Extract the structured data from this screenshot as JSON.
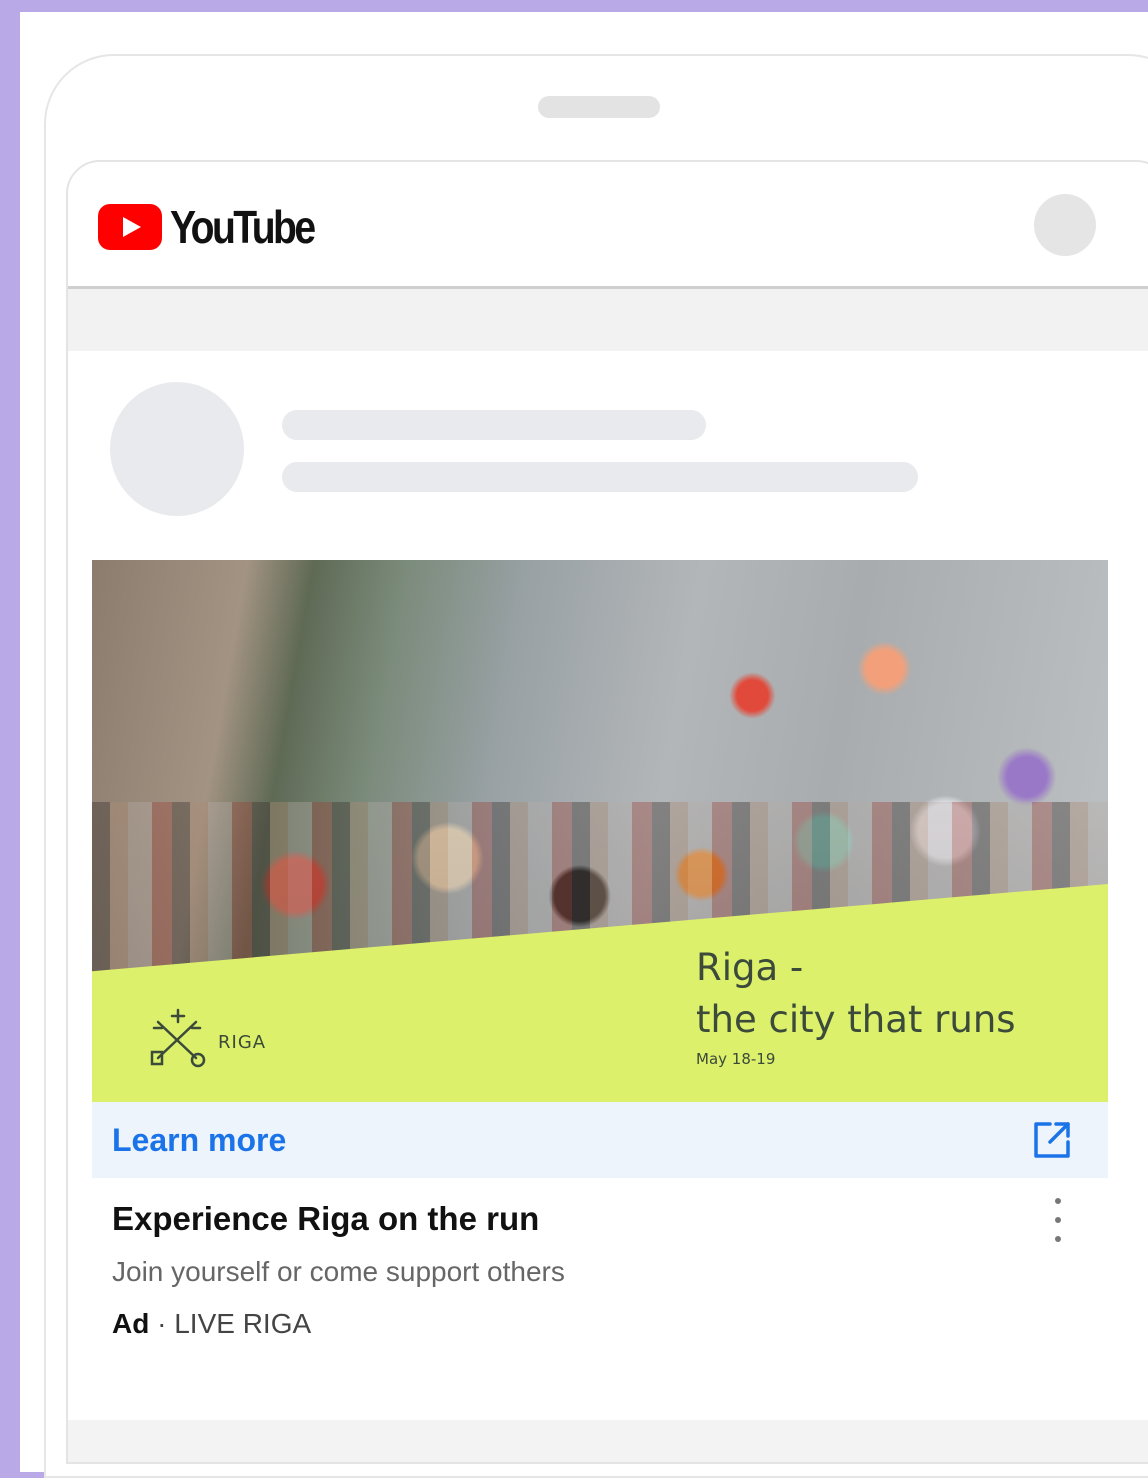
{
  "app": {
    "brand": "YouTube"
  },
  "ad": {
    "image_title_line1": "Riga -",
    "image_title_line2": "the city that runs",
    "image_date": "May 18-19",
    "logo_text": "RIGA",
    "cta_label": "Learn more",
    "headline": "Experience Riga on the run",
    "description": "Join yourself or come support others",
    "badge": "Ad",
    "separator": "·",
    "advertiser": "LIVE RIGA"
  },
  "colors": {
    "background": "#b9a9e6",
    "youtube_red": "#ff0000",
    "cta_blue": "#1a73e8",
    "ad_band_green": "#dcf06b"
  },
  "icons": [
    "play-logo-icon",
    "avatar-placeholder",
    "riga-keys-logo-icon",
    "external-link-icon",
    "more-vert-icon"
  ]
}
